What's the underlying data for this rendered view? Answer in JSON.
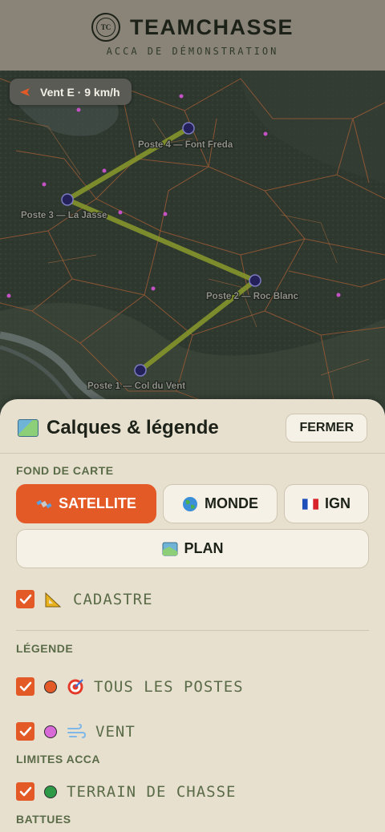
{
  "header": {
    "logo_text": "TC",
    "title": "TEAMCHASSE",
    "subtitle": "ACCA DE DÉMONSTRATION"
  },
  "map": {
    "wind_label": "Vent E · 9 km/h",
    "posts": [
      {
        "label": "Poste 4 — Font Freda"
      },
      {
        "label": "Poste 3 — La Jasse"
      },
      {
        "label": "Poste 2 — Roc Blanc"
      },
      {
        "label": "Poste 1 — Col du Vent"
      }
    ]
  },
  "sheet": {
    "title": "Calques & légende",
    "close_label": "FERMER",
    "basemap_section": "FOND DE CARTE",
    "basemaps": [
      {
        "label": "SATELLITE",
        "icon": "satellite-icon",
        "active": true
      },
      {
        "label": "MONDE",
        "icon": "globe-icon",
        "active": false
      },
      {
        "label": "IGN",
        "icon": "french-flag-icon",
        "active": false
      },
      {
        "label": "PLAN",
        "icon": "map-icon",
        "active": false
      }
    ],
    "cadastre_label": "CADASTRE",
    "legend_section": "LÉGENDE",
    "legend": [
      {
        "label": "TOUS LES POSTES",
        "checked": true,
        "color": "#e35a27",
        "icon": "target-icon"
      },
      {
        "label": "VENT",
        "checked": true,
        "color": "#d86ad8",
        "icon": "wind-icon"
      }
    ],
    "limits_section": "LIMITES ACCA",
    "limits": [
      {
        "label": "TERRAIN DE CHASSE",
        "checked": true,
        "color": "#2e9a47"
      }
    ],
    "battues_section": "BATTUES"
  },
  "colors": {
    "accent": "#e35a27",
    "header_bg": "#8a8478",
    "sheet_bg": "#e8e0cf",
    "route": "#8a9a2a",
    "post_marker": "#23205a"
  }
}
